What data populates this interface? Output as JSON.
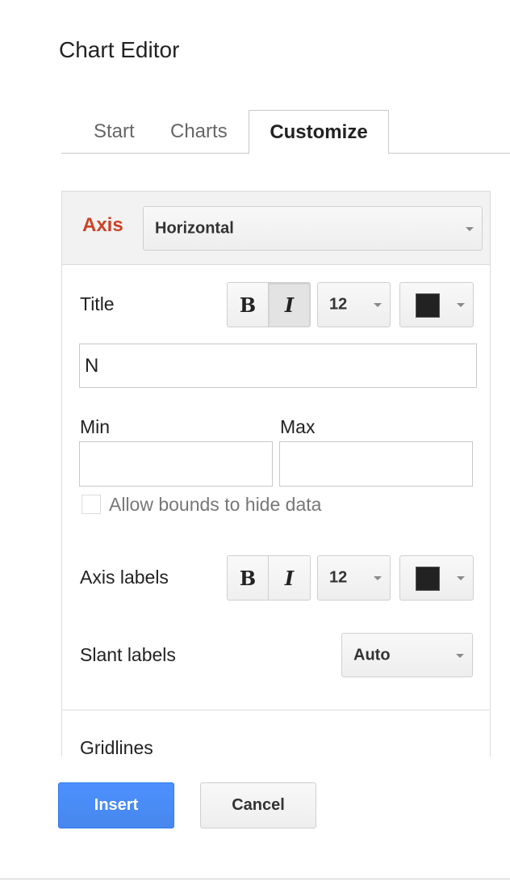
{
  "dialog": {
    "title": "Chart Editor"
  },
  "tabs": [
    {
      "label": "Start",
      "active": false
    },
    {
      "label": "Charts",
      "active": false
    },
    {
      "label": "Customize",
      "active": true
    }
  ],
  "axis": {
    "label": "Axis",
    "selected": "Horizontal"
  },
  "title_section": {
    "label": "Title",
    "bold_label": "B",
    "italic_label": "I",
    "bold_pressed": false,
    "italic_pressed": true,
    "font_size": "12",
    "color": "#222222",
    "value": "N"
  },
  "bounds": {
    "min_label": "Min",
    "max_label": "Max",
    "min_value": "",
    "max_value": "",
    "allow_hide_label": "Allow bounds to hide data",
    "allow_hide_checked": false
  },
  "axis_labels": {
    "label": "Axis labels",
    "bold_label": "B",
    "italic_label": "I",
    "font_size": "12",
    "color": "#222222"
  },
  "slant_labels": {
    "label": "Slant labels",
    "selected": "Auto"
  },
  "gridlines": {
    "label": "Gridlines"
  },
  "footer": {
    "insert_label": "Insert",
    "cancel_label": "Cancel"
  },
  "colors": {
    "accent": "#cc4125",
    "primary_button": "#4d90fe"
  }
}
